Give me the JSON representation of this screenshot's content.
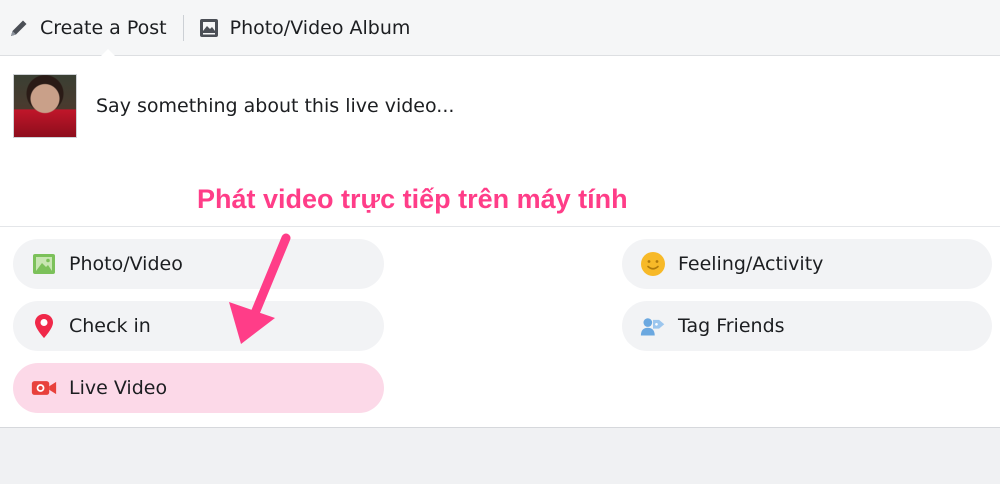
{
  "tabs": {
    "create_post": "Create a Post",
    "photo_album": "Photo/Video Album"
  },
  "composer": {
    "placeholder": "Say something about this live video..."
  },
  "annotation": {
    "text": "Phát video trực tiếp trên máy tính",
    "color": "#ff3d88"
  },
  "options": {
    "photo_video": {
      "label": "Photo/Video",
      "icon": "photo-icon"
    },
    "check_in": {
      "label": "Check in",
      "icon": "location-pin-icon"
    },
    "live_video": {
      "label": "Live Video",
      "icon": "video-camera-icon",
      "highlighted": true
    },
    "feeling": {
      "label": "Feeling/Activity",
      "icon": "smiley-icon"
    },
    "tag_friends": {
      "label": "Tag Friends",
      "icon": "tag-friends-icon"
    }
  },
  "colors": {
    "highlight": "#fcd9e8",
    "pill": "#f2f3f5",
    "live_red": "#e8413c"
  }
}
